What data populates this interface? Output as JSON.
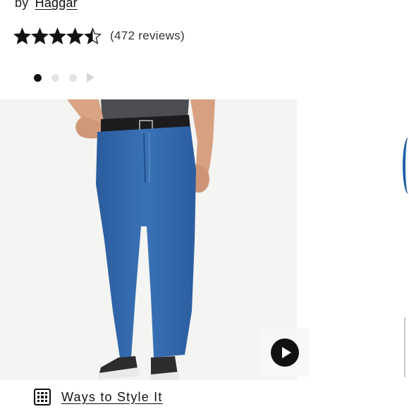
{
  "product": {
    "by_prefix": "by",
    "brand": "Haggar"
  },
  "rating": {
    "value": 4.5,
    "max": 5,
    "review_count_text": "(472 reviews)"
  },
  "carousel": {
    "active_index": 0,
    "dot_count": 3,
    "next_icon": "chevron-right-icon"
  },
  "media": {
    "video_icon": "play-icon"
  },
  "style_link": {
    "icon": "grid-icon",
    "label": "Ways to Style It"
  },
  "colors": {
    "accent": "#111111",
    "denim": "#2f63a6",
    "image_background": "#f4f4f2"
  }
}
